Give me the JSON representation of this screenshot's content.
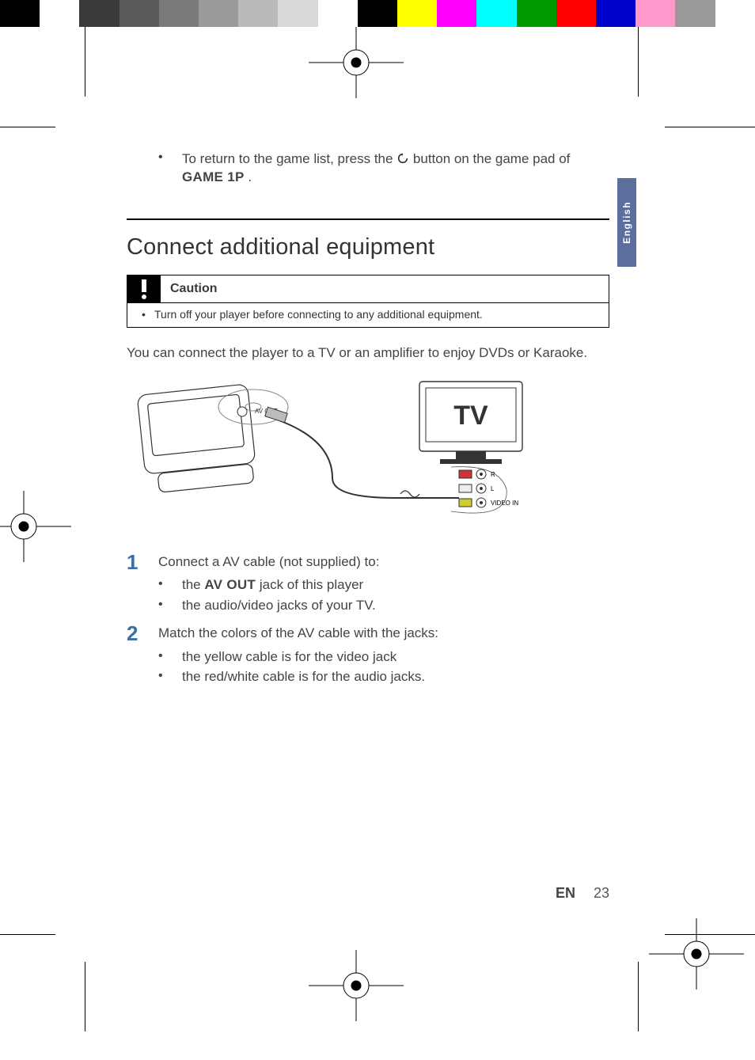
{
  "sidetab": {
    "label": "English"
  },
  "top_bullet": {
    "text_before": "To return to the game list, press the ",
    "text_after": " button on the game pad of ",
    "bold_tail": "GAME 1P",
    "tail_punct": " ."
  },
  "section_heading": "Connect additional equipment",
  "caution": {
    "label": "Caution",
    "item": "Turn off your player before connecting to any additional equipment."
  },
  "description": "You can connect the player to a TV or an amplifier to enjoy DVDs or Karaoke.",
  "diagram": {
    "tv_label": "TV",
    "avout_label": "AV OUT",
    "jack_r": "R",
    "jack_l": "L",
    "jack_video": "VIDEO IN"
  },
  "steps": [
    {
      "num": "1",
      "text": "Connect a AV cable (not supplied) to:",
      "subs": [
        {
          "pre": "the ",
          "bold": "AV OUT",
          "post": " jack of this player"
        },
        {
          "pre": "the audio/video jacks of your TV.",
          "bold": "",
          "post": ""
        }
      ]
    },
    {
      "num": "2",
      "text": "Match the colors of the AV cable with the jacks:",
      "subs": [
        {
          "pre": "the yellow cable is for the video jack",
          "bold": "",
          "post": ""
        },
        {
          "pre": "the red/white cable is for the audio jacks.",
          "bold": "",
          "post": ""
        }
      ]
    }
  ],
  "footer": {
    "lang": "EN",
    "page": "23"
  },
  "colorbar": [
    "#000000",
    "#ffffff",
    "#3a3a3a",
    "#5a5a5a",
    "#7a7a7a",
    "#9a9a9a",
    "#bababa",
    "#dadada",
    "#ffffff",
    "#000000",
    "#ffff00",
    "#ff00ff",
    "#00ffff",
    "#009900",
    "#ff0000",
    "#0000cc",
    "#ff99cc",
    "#999999",
    "#ffffff"
  ]
}
